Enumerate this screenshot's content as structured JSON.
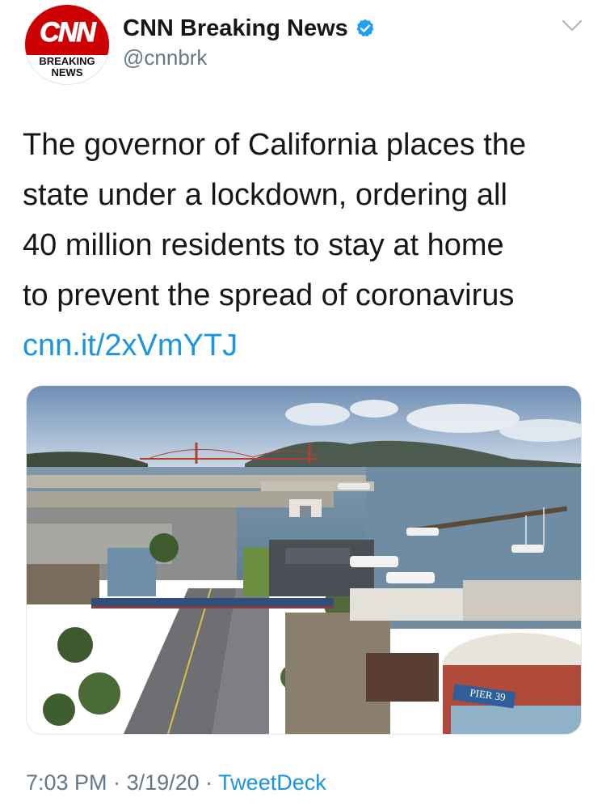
{
  "account": {
    "display_name": "CNN Breaking News",
    "handle": "@cnnbrk",
    "avatar_logo": "CNN",
    "avatar_line1": "BREAKING",
    "avatar_line2": "NEWS",
    "verified_icon": "verified-badge-icon"
  },
  "tweet": {
    "lines": [
      "The governor of California places the",
      "state under a lockdown, ordering all",
      "40 million residents to stay at home",
      "to prevent the spread of coronavirus"
    ],
    "link": "cnn.it/2xVmYTJ"
  },
  "photo": {
    "signs": [
      "PIER 39"
    ]
  },
  "meta": {
    "time": "7:03 PM",
    "separator": " · ",
    "date": "3/19/20",
    "source": "TweetDeck"
  },
  "colors": {
    "link": "#1b95e0",
    "secondary_text": "#657786",
    "cnn_red": "#cc0000",
    "verified": "#1da1f2"
  }
}
